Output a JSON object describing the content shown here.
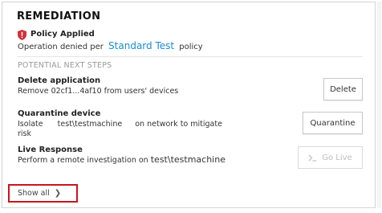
{
  "remediation": {
    "title": "REMEDIATION",
    "policy": {
      "title": "Policy Applied",
      "prefix": "Operation denied per",
      "link": "Standard Test",
      "suffix": "policy",
      "icon": "shield-alert-icon",
      "icon_color": "#d13438"
    },
    "next_steps_label": "POTENTIAL NEXT STEPS",
    "actions": {
      "delete": {
        "title": "Delete application",
        "description": "Remove 02cf1...4af10 from users' devices",
        "button": "Delete"
      },
      "quarantine": {
        "title": "Quarantine device",
        "desc_prefix": "Isolate",
        "device": "test\\testmachine",
        "desc_suffix": "on network to mitigate",
        "desc_line2": "risk",
        "button": "Quarantine"
      },
      "live_response": {
        "title": "Live Response",
        "desc_prefix": "Perform a remote investigation on",
        "device": "test\\testmachine",
        "button": "Go Live",
        "button_icon": "terminal-icon",
        "button_disabled": true
      }
    },
    "show_all": "Show all",
    "highlight_color": "#c8161d"
  }
}
